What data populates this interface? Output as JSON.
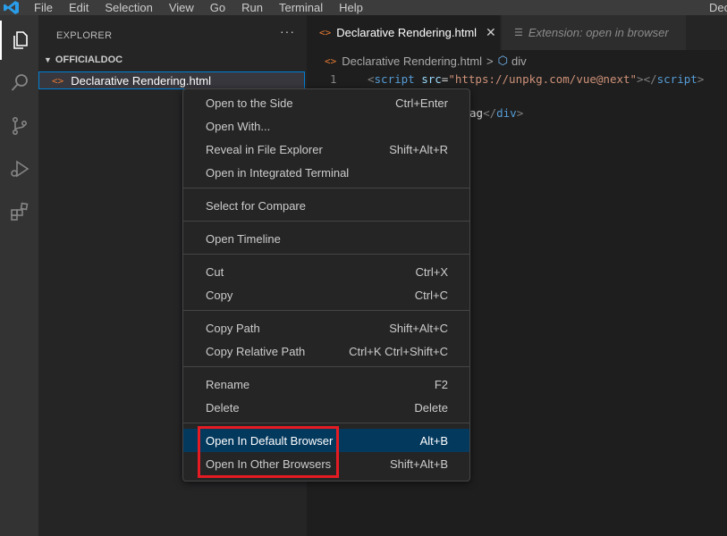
{
  "app": {
    "menu": [
      "File",
      "Edit",
      "Selection",
      "View",
      "Go",
      "Run",
      "Terminal",
      "Help"
    ],
    "window_title": "Dec"
  },
  "activity_bar": [
    "explorer-icon",
    "search-icon",
    "source-control-icon",
    "run-debug-icon",
    "extensions-icon"
  ],
  "sidebar": {
    "header": "EXPLORER",
    "more": "···",
    "folder": "OFFICIALDOC",
    "file": "Declarative Rendering.html",
    "file_icon": "<>"
  },
  "tabs": [
    {
      "label": "Declarative Rendering.html",
      "icon": "<>",
      "close": "✕"
    },
    {
      "label": "Extension: open in browser",
      "icon": "☰"
    }
  ],
  "breadcrumb": {
    "file": "Declarative Rendering.html",
    "separator": ">",
    "symbol": "div",
    "symbol_icon": "⬡"
  },
  "editor": {
    "line_number": "1",
    "line1": {
      "open_tag": "<",
      "tag": "script",
      "attr": "src",
      "eq": "=",
      "value": "\"https://unpkg.com/vue@next\"",
      "mid": "></",
      "close_tag": "script",
      "end": ">"
    },
    "line3_partial": "ag",
    "line3_close": "</",
    "line3_tag": "div",
    "line3_end": ">"
  },
  "context_menu": {
    "items": [
      {
        "label": "Open to the Side",
        "shortcut": "Ctrl+Enter"
      },
      {
        "label": "Open With...",
        "shortcut": ""
      },
      {
        "label": "Reveal in File Explorer",
        "shortcut": "Shift+Alt+R"
      },
      {
        "label": "Open in Integrated Terminal",
        "shortcut": ""
      },
      {
        "label": "Select for Compare",
        "shortcut": ""
      },
      {
        "label": "Open Timeline",
        "shortcut": ""
      },
      {
        "label": "Cut",
        "shortcut": "Ctrl+X"
      },
      {
        "label": "Copy",
        "shortcut": "Ctrl+C"
      },
      {
        "label": "Copy Path",
        "shortcut": "Shift+Alt+C"
      },
      {
        "label": "Copy Relative Path",
        "shortcut": "Ctrl+K Ctrl+Shift+C"
      },
      {
        "label": "Rename",
        "shortcut": "F2"
      },
      {
        "label": "Delete",
        "shortcut": "Delete"
      },
      {
        "label": "Open In Default Browser",
        "shortcut": "Alt+B"
      },
      {
        "label": "Open In Other Browsers",
        "shortcut": "Shift+Alt+B"
      }
    ],
    "highlighted_index": 12
  },
  "colors": {
    "highlight": "#04395e",
    "annotation_box": "#e51b23",
    "accent": "#007fd4"
  }
}
